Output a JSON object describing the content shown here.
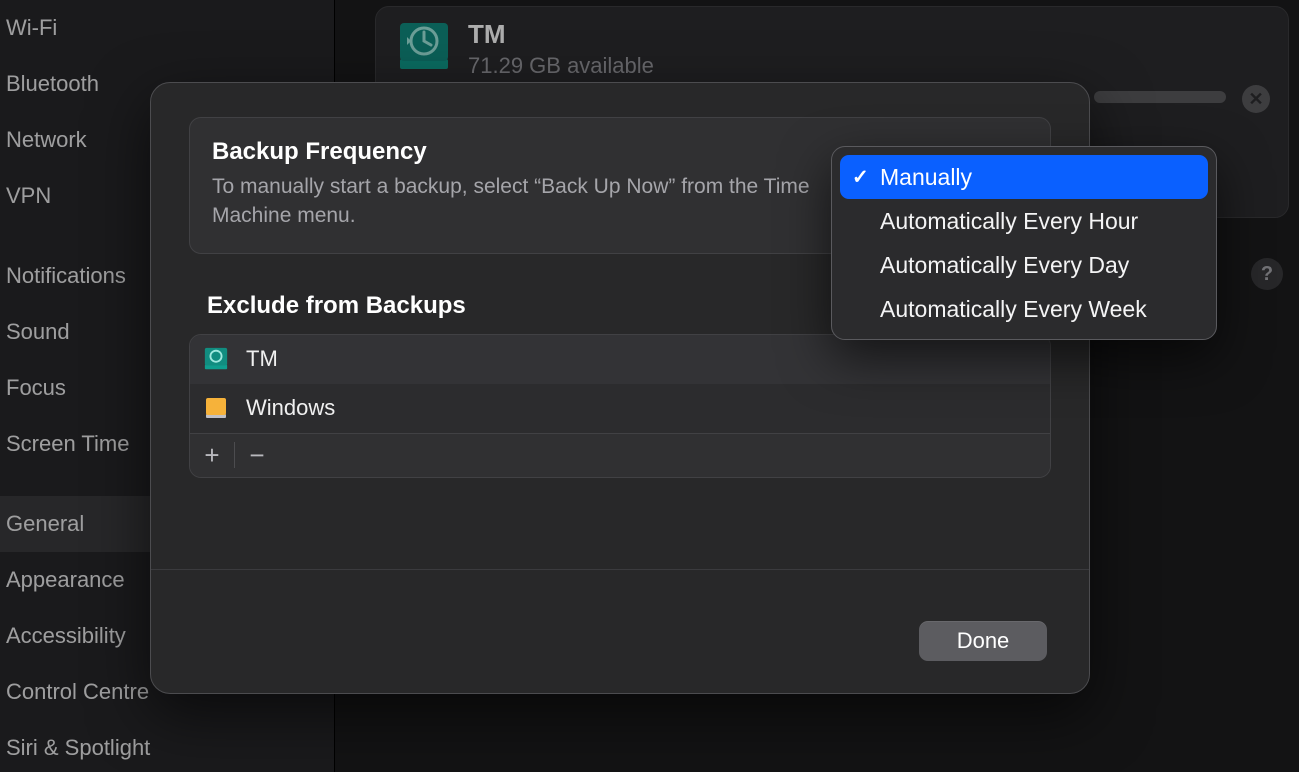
{
  "sidebar": {
    "items": [
      {
        "label": "Wi-Fi"
      },
      {
        "label": "Bluetooth"
      },
      {
        "label": "Network"
      },
      {
        "label": "VPN"
      },
      {
        "label": "Notifications"
      },
      {
        "label": "Sound"
      },
      {
        "label": "Focus"
      },
      {
        "label": "Screen Time"
      },
      {
        "label": "General",
        "selected": true
      },
      {
        "label": "Appearance"
      },
      {
        "label": "Accessibility"
      },
      {
        "label": "Control Centre"
      },
      {
        "label": "Siri & Spotlight"
      }
    ]
  },
  "disk": {
    "name": "TM",
    "available": "71.29 GB available"
  },
  "sheet": {
    "frequency_title": "Backup Frequency",
    "frequency_desc": "To manually start a backup, select “Back Up Now” from the Time Machine menu.",
    "exclude_title": "Exclude from Backups",
    "exclude_items": [
      {
        "label": "TM",
        "icon": "tm"
      },
      {
        "label": "Windows",
        "icon": "ext"
      }
    ],
    "done_label": "Done"
  },
  "menu": {
    "items": [
      {
        "label": "Manually",
        "selected": true
      },
      {
        "label": "Automatically Every Hour"
      },
      {
        "label": "Automatically Every Day"
      },
      {
        "label": "Automatically Every Week"
      }
    ]
  },
  "glyphs": {
    "check": "✓",
    "close": "✕",
    "question": "?",
    "plus": "+",
    "minus": "−"
  }
}
